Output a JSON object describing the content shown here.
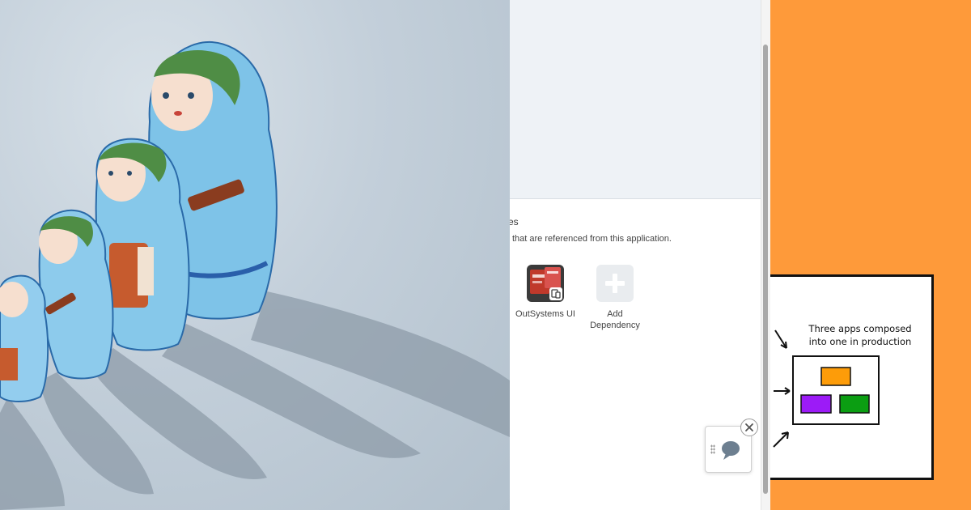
{
  "left_photo": {
    "subject": "matryoshka nesting dolls casting shadows"
  },
  "app_panel": {
    "section_heading_fragment": "es",
    "section_description": "that are referenced from this application.",
    "dependencies": [
      {
        "label": "OutSystems UI",
        "icon": "outsystems-ui-icon"
      },
      {
        "label_line1": "Add",
        "label_line2": "Dependency",
        "icon": "plus-icon"
      }
    ],
    "chat_widget": {
      "icon": "chat-bubble-icon",
      "close_icon": "close-icon"
    }
  },
  "orange_panel": {
    "accent_color": "#fe9a3a",
    "whiteboard": {
      "title_line1": "Three apps composed",
      "title_line2": "into one in production",
      "box_colors": [
        "#fd9c09",
        "#9c1bf7",
        "#0b9e12"
      ]
    }
  }
}
